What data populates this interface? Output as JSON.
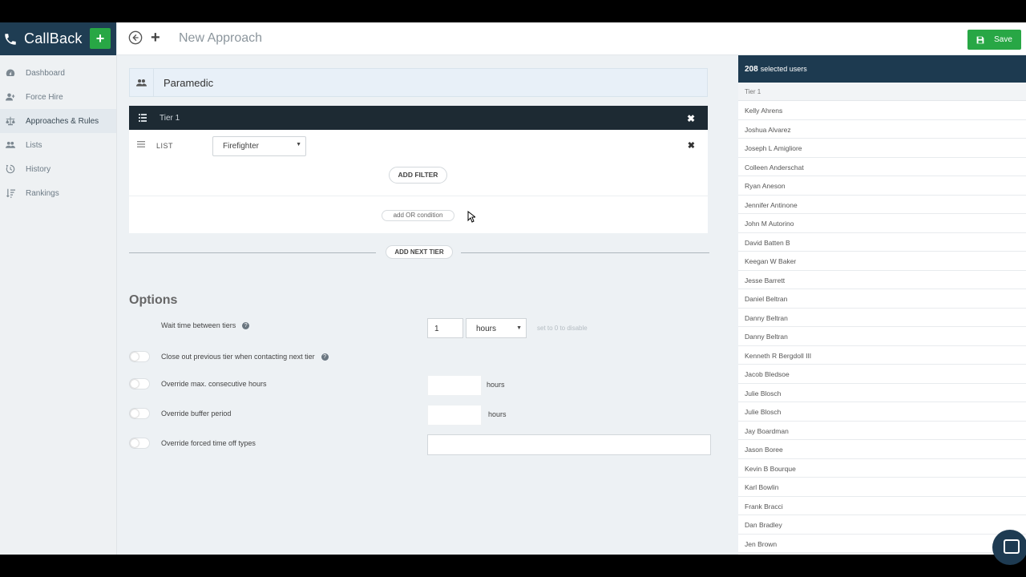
{
  "app": {
    "brand": "CallBack",
    "title": "New Approach",
    "save_label": "Save"
  },
  "sidebar": {
    "items": [
      {
        "label": "Dashboard",
        "icon": "dashboard-icon"
      },
      {
        "label": "Force Hire",
        "icon": "user-plus-icon"
      },
      {
        "label": "Approaches & Rules",
        "icon": "balance-scale-icon",
        "active": true
      },
      {
        "label": "Lists",
        "icon": "users-icon"
      },
      {
        "label": "History",
        "icon": "history-icon"
      },
      {
        "label": "Rankings",
        "icon": "sort-amount-icon"
      }
    ]
  },
  "approach": {
    "name": "Paramedic",
    "tier": {
      "label": "Tier 1",
      "list_label": "LIST",
      "list_value": "Firefighter",
      "add_filter": "ADD FILTER",
      "add_or": "add OR condition"
    },
    "add_next_tier": "ADD NEXT TIER"
  },
  "options": {
    "title": "Options",
    "wait_label": "Wait time between tiers",
    "wait_value": "1",
    "wait_unit": "hours",
    "wait_hint": "set to 0 to disable",
    "close_out_label": "Close out previous tier when contacting next tier",
    "max_hours_label": "Override max. consecutive hours",
    "max_hours_unit": "hours",
    "buffer_label": "Override buffer period",
    "buffer_unit": "hours",
    "timeoff_label": "Override forced time off types"
  },
  "selected": {
    "count": "208",
    "count_label": "selected users",
    "tier_label": "Tier 1",
    "users": [
      "Kelly Ahrens",
      "Joshua Alvarez",
      "Joseph L Amigliore",
      "Colleen Anderschat",
      "Ryan Aneson",
      "Jennifer Antinone",
      "John M Autorino",
      "David Batten B",
      "Keegan W Baker",
      "Jesse Barrett",
      "Daniel Beltran",
      "Danny Beltran",
      "Danny Beltran",
      "Kenneth R Bergdoll III",
      "Jacob Bledsoe",
      "Julie Blosch",
      "Julie Blosch",
      "Jay Boardman",
      "Jason Boree",
      "Kevin B Bourque",
      "Karl Bowlin",
      "Frank Bracci",
      "Dan Bradley",
      "Jen Brown"
    ]
  }
}
